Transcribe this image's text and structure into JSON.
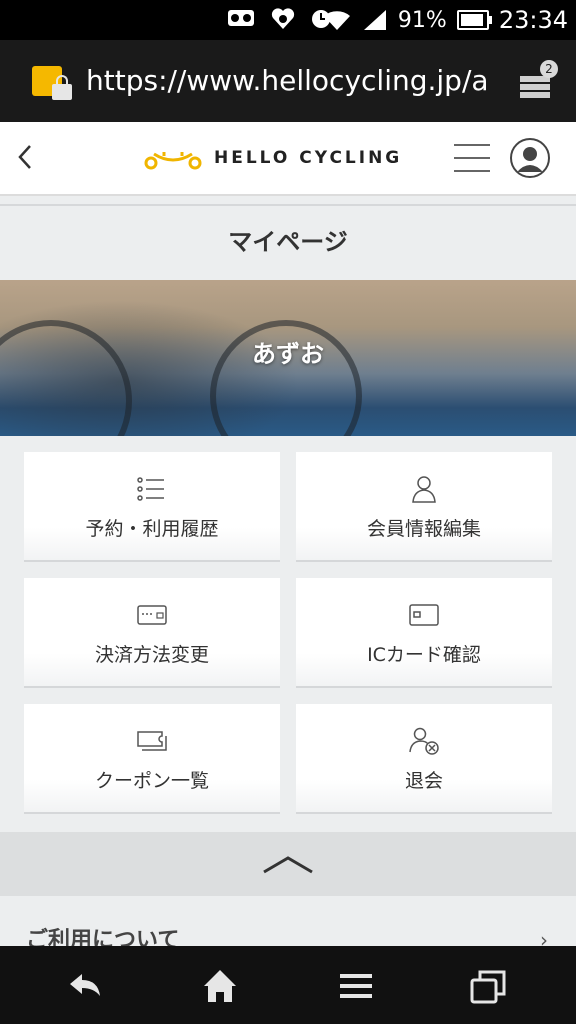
{
  "status_bar": {
    "battery_percent": "91%",
    "time": "23:34"
  },
  "browser": {
    "url": "https://www.hellocycling.jp/app",
    "tab_count": "2"
  },
  "header": {
    "brand": "HELLO CYCLING"
  },
  "page": {
    "title": "マイページ",
    "user_name": "あずお"
  },
  "menu": {
    "reservation_history": "予約・利用履歴",
    "member_info": "会員情報編集",
    "payment_method": "決済方法変更",
    "ic_card": "ICカード確認",
    "coupons": "クーポン一覧",
    "withdraw": "退会"
  },
  "footer": {
    "about": "ご利用について"
  },
  "colors": {
    "brand_yellow": "#f5b800",
    "background": "#eceeef"
  }
}
